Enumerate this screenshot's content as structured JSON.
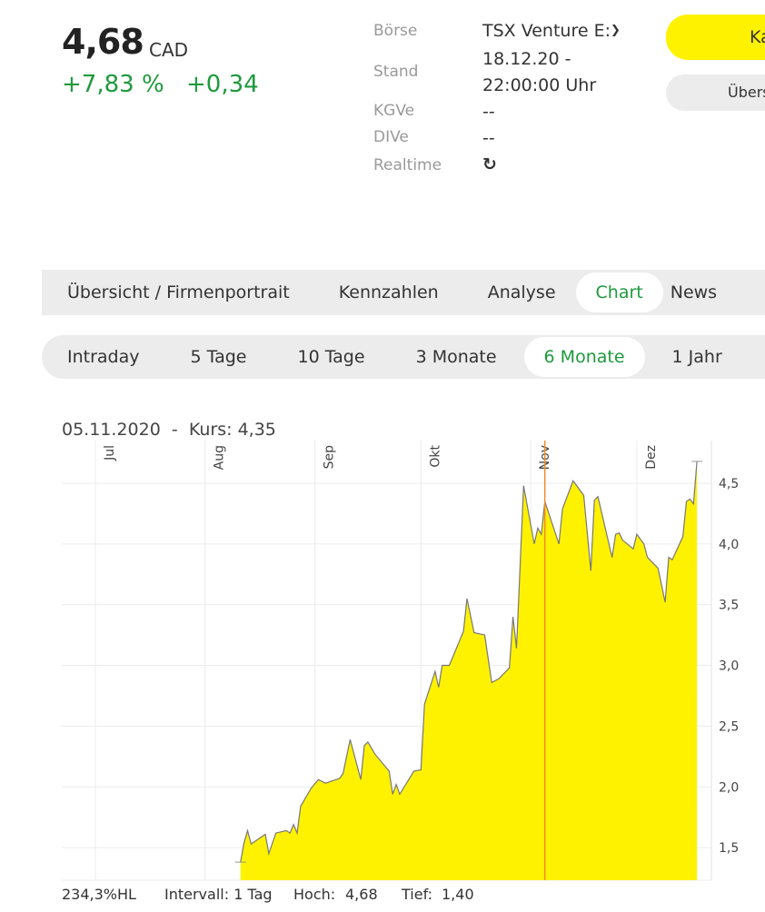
{
  "quote": {
    "price": "4,68",
    "currency": "CAD",
    "change_pct": "+7,83 %",
    "change_abs": "+0,34"
  },
  "details": [
    {
      "label": "Börse",
      "value": "TSX Venture E:"
    },
    {
      "label": "Stand",
      "value": "18.12.20 -",
      "value2": "22:00:00 Uhr"
    },
    {
      "label": "KGVe",
      "value": "--"
    },
    {
      "label": "DIVe",
      "value": "--"
    },
    {
      "label": "Realtime",
      "icon": "realtime-refresh-icon"
    }
  ],
  "buttons": {
    "primary": "Kaufen",
    "secondary": "Übersicht"
  },
  "nav_tabs": [
    {
      "label": "Übersicht / Firmenportrait"
    },
    {
      "label": "Kennzahlen"
    },
    {
      "label": "Analyse"
    },
    {
      "label": "Chart",
      "active": true
    },
    {
      "label": "News"
    }
  ],
  "range_tabs": [
    {
      "label": "Intraday"
    },
    {
      "label": "5 Tage"
    },
    {
      "label": "10 Tage"
    },
    {
      "label": "3 Monate"
    },
    {
      "label": "6 Monate",
      "active": true
    },
    {
      "label": "1 Jahr"
    }
  ],
  "colors": {
    "accent_green": "#1e9a3c",
    "brand_yellow": "#fff200",
    "area_fill": "#fff200",
    "crosshair": "#f28c28"
  },
  "chart_info": {
    "date": "05.11.2020",
    "sep": "-",
    "kurs_label": "Kurs:",
    "kurs": "4,35"
  },
  "footer": {
    "hl": "234,3%HL",
    "interval": "Intervall: 1 Tag",
    "hoch_label": "Hoch:",
    "hoch": "4,68",
    "tief_label": "Tief:",
    "tief": "1,40"
  },
  "chart_data": {
    "type": "area",
    "x_ticks": [
      "Jul",
      "Aug",
      "Sep",
      "Okt",
      "Nov",
      "Dez"
    ],
    "y_ticks": [
      "1,5",
      "2,0",
      "2,5",
      "3,0",
      "3,5",
      "4,0",
      "4,5"
    ],
    "ylim": [
      1.23,
      4.8
    ],
    "grid": true,
    "crosshair_date": "2020-11-05",
    "points": [
      [
        "2020-08-11",
        1.38
      ],
      [
        "2020-08-12",
        1.54
      ],
      [
        "2020-08-13",
        1.64
      ],
      [
        "2020-08-14",
        1.53
      ],
      [
        "2020-08-18",
        1.61
      ],
      [
        "2020-08-19",
        1.45
      ],
      [
        "2020-08-21",
        1.62
      ],
      [
        "2020-08-24",
        1.64
      ],
      [
        "2020-08-25",
        1.62
      ],
      [
        "2020-08-26",
        1.69
      ],
      [
        "2020-08-27",
        1.62
      ],
      [
        "2020-08-28",
        1.84
      ],
      [
        "2020-08-31",
        1.99
      ],
      [
        "2020-09-02",
        2.06
      ],
      [
        "2020-09-04",
        2.03
      ],
      [
        "2020-09-08",
        2.07
      ],
      [
        "2020-09-09",
        2.11
      ],
      [
        "2020-09-11",
        2.39
      ],
      [
        "2020-09-14",
        2.06
      ],
      [
        "2020-09-15",
        2.34
      ],
      [
        "2020-09-16",
        2.37
      ],
      [
        "2020-09-18",
        2.27
      ],
      [
        "2020-09-22",
        2.13
      ],
      [
        "2020-09-23",
        1.94
      ],
      [
        "2020-09-24",
        2.02
      ],
      [
        "2020-09-25",
        1.94
      ],
      [
        "2020-09-29",
        2.13
      ],
      [
        "2020-10-01",
        2.14
      ],
      [
        "2020-10-02",
        2.68
      ],
      [
        "2020-10-05",
        2.95
      ],
      [
        "2020-10-06",
        2.82
      ],
      [
        "2020-10-07",
        3.0
      ],
      [
        "2020-10-09",
        3.0
      ],
      [
        "2020-10-13",
        3.28
      ],
      [
        "2020-10-14",
        3.55
      ],
      [
        "2020-10-16",
        3.27
      ],
      [
        "2020-10-19",
        3.25
      ],
      [
        "2020-10-21",
        2.86
      ],
      [
        "2020-10-23",
        2.89
      ],
      [
        "2020-10-26",
        2.98
      ],
      [
        "2020-10-27",
        3.4
      ],
      [
        "2020-10-28",
        3.14
      ],
      [
        "2020-10-30",
        4.48
      ],
      [
        "2020-11-02",
        4.0
      ],
      [
        "2020-11-03",
        4.13
      ],
      [
        "2020-11-04",
        4.08
      ],
      [
        "2020-11-05",
        4.35
      ],
      [
        "2020-11-09",
        4.0
      ],
      [
        "2020-11-10",
        4.29
      ],
      [
        "2020-11-13",
        4.52
      ],
      [
        "2020-11-16",
        4.4
      ],
      [
        "2020-11-18",
        3.78
      ],
      [
        "2020-11-19",
        4.36
      ],
      [
        "2020-11-20",
        4.39
      ],
      [
        "2020-11-24",
        3.89
      ],
      [
        "2020-11-25",
        4.08
      ],
      [
        "2020-11-26",
        4.09
      ],
      [
        "2020-11-27",
        4.03
      ],
      [
        "2020-11-30",
        3.96
      ],
      [
        "2020-12-01",
        4.08
      ],
      [
        "2020-12-03",
        4.0
      ],
      [
        "2020-12-04",
        3.89
      ],
      [
        "2020-12-07",
        3.8
      ],
      [
        "2020-12-09",
        3.52
      ],
      [
        "2020-12-10",
        3.89
      ],
      [
        "2020-12-11",
        3.87
      ],
      [
        "2020-12-14",
        4.06
      ],
      [
        "2020-12-15",
        4.35
      ],
      [
        "2020-12-16",
        4.37
      ],
      [
        "2020-12-17",
        4.33
      ],
      [
        "2020-12-18",
        4.68
      ]
    ]
  }
}
